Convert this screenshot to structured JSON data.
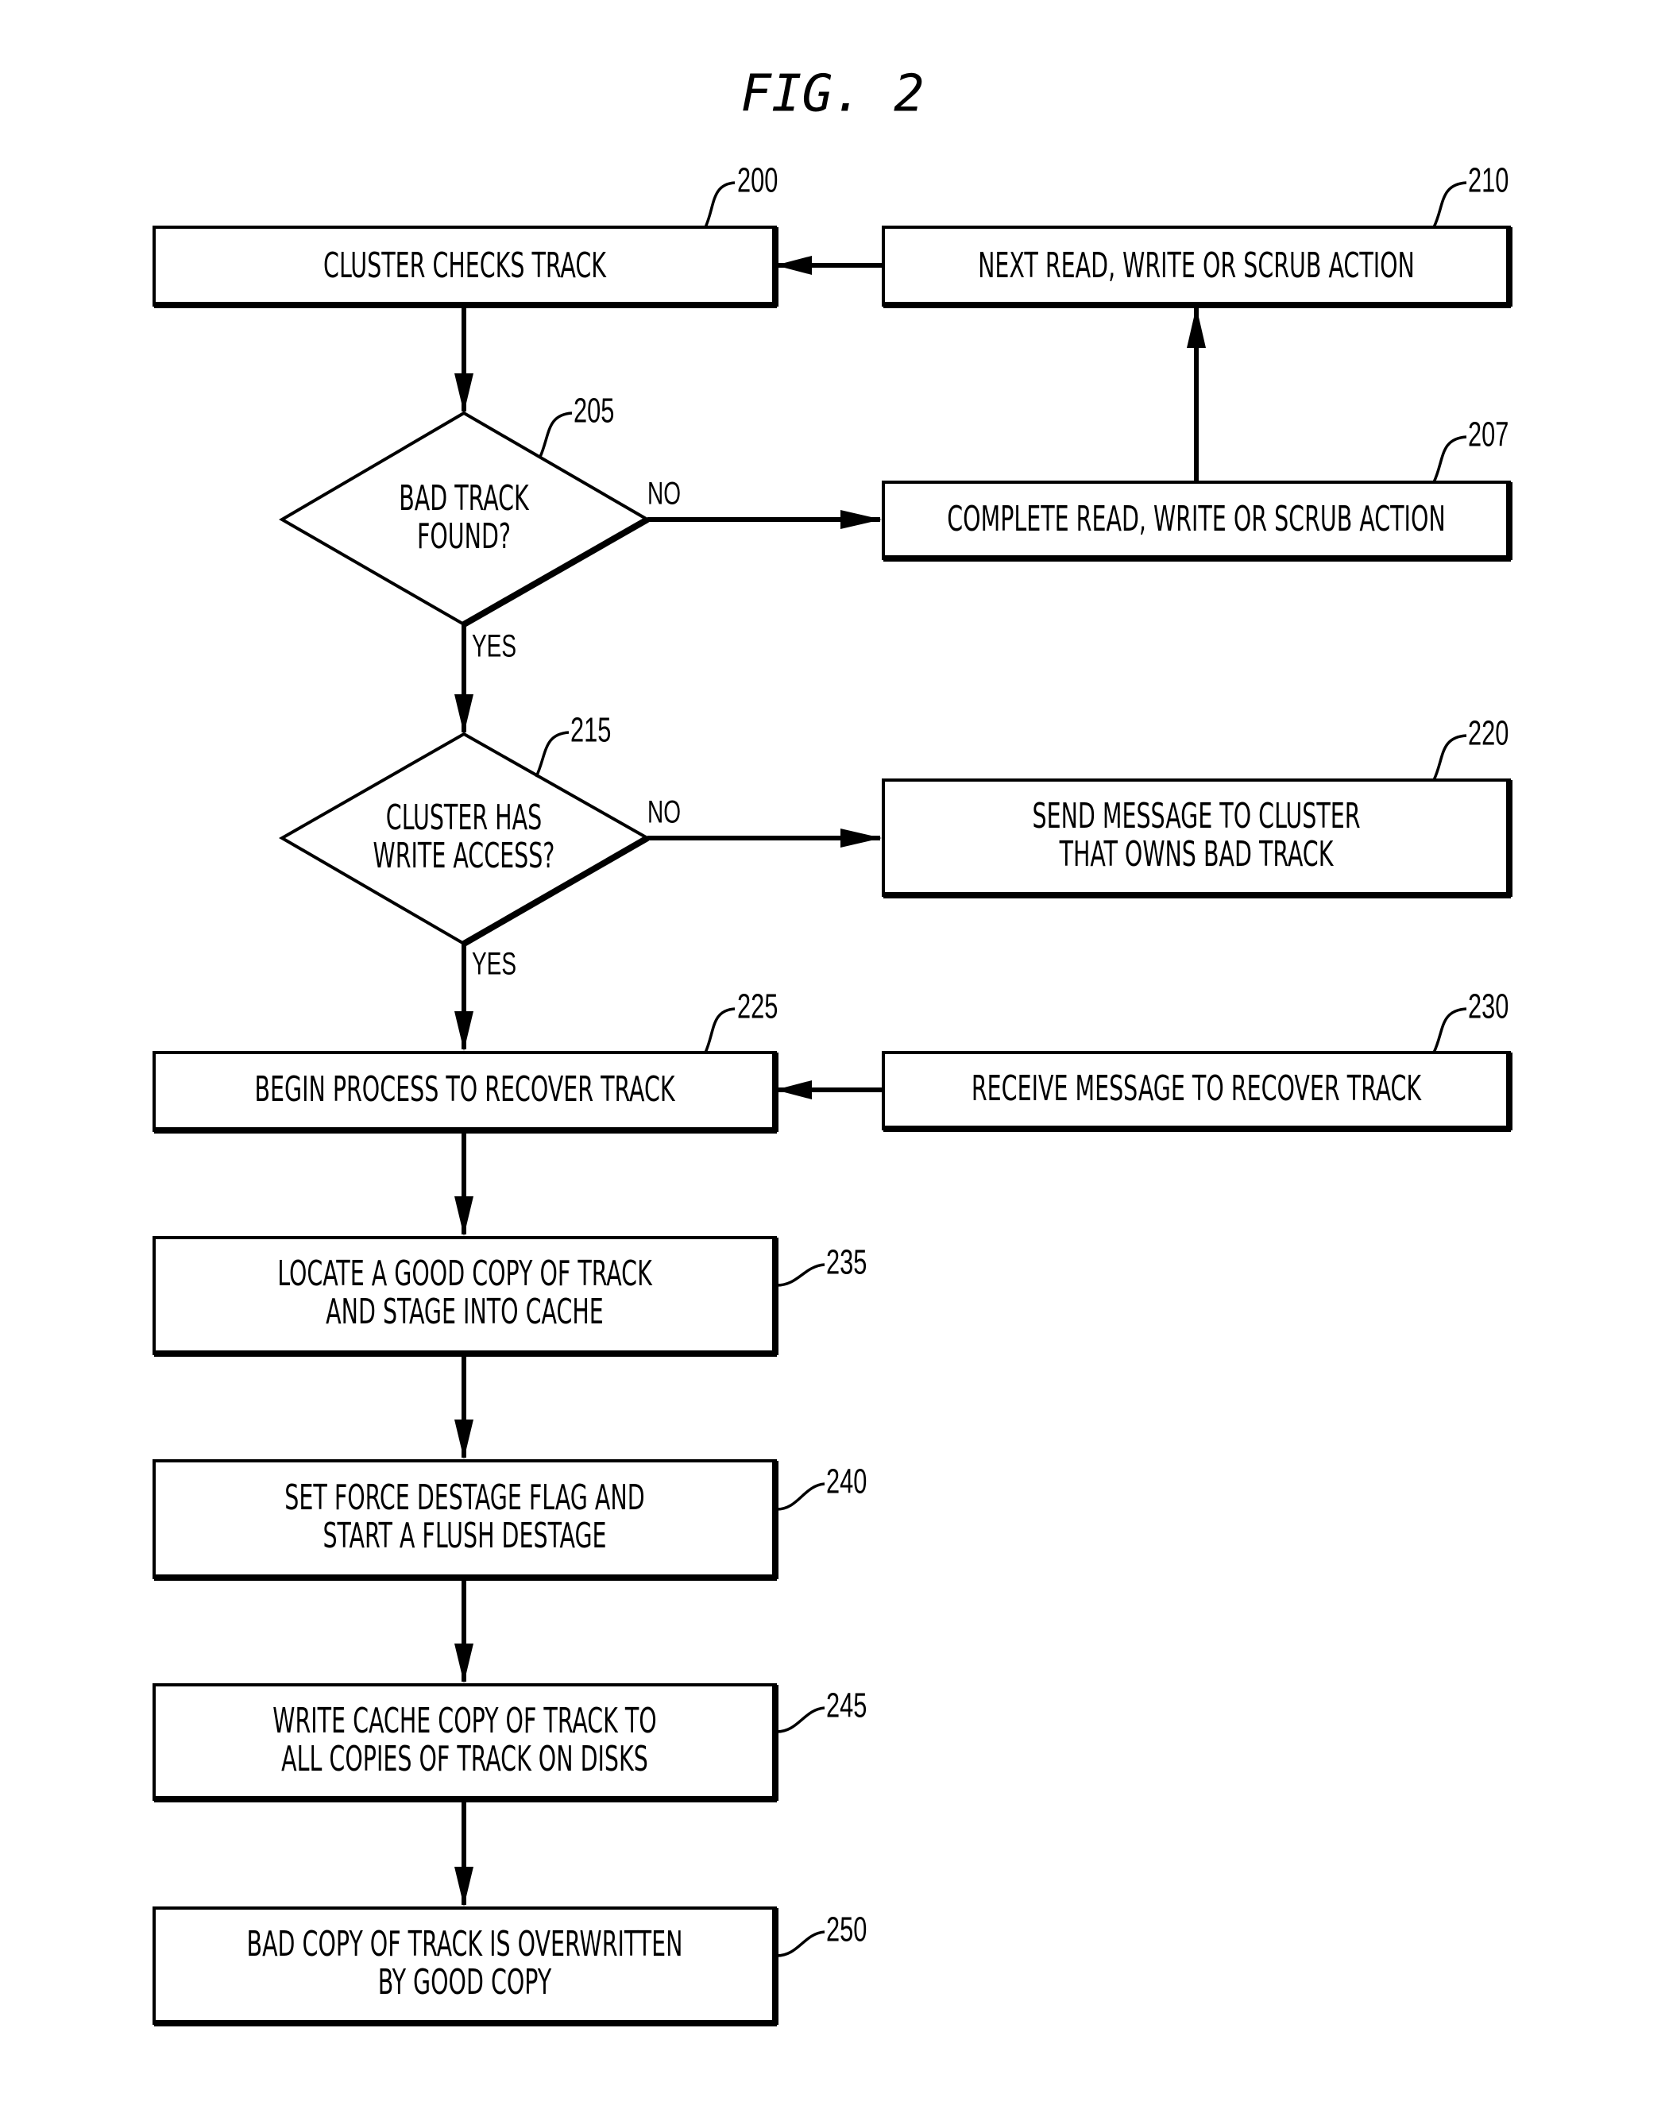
{
  "figure": {
    "title": "FIG. 2"
  },
  "nodes": {
    "n200": {
      "ref": "200",
      "lines": [
        "CLUSTER CHECKS TRACK"
      ]
    },
    "n210": {
      "ref": "210",
      "lines": [
        "NEXT READ, WRITE OR SCRUB ACTION"
      ]
    },
    "n205": {
      "ref": "205",
      "lines": [
        "BAD TRACK",
        "FOUND?"
      ]
    },
    "n207": {
      "ref": "207",
      "lines": [
        "COMPLETE READ, WRITE OR SCRUB ACTION"
      ]
    },
    "n215": {
      "ref": "215",
      "lines": [
        "CLUSTER HAS",
        "WRITE ACCESS?"
      ]
    },
    "n220": {
      "ref": "220",
      "lines": [
        "SEND MESSAGE TO CLUSTER",
        "THAT OWNS BAD TRACK"
      ]
    },
    "n225": {
      "ref": "225",
      "lines": [
        "BEGIN PROCESS TO RECOVER TRACK"
      ]
    },
    "n230": {
      "ref": "230",
      "lines": [
        "RECEIVE MESSAGE TO RECOVER TRACK"
      ]
    },
    "n235": {
      "ref": "235",
      "lines": [
        "LOCATE A GOOD COPY OF TRACK",
        "AND STAGE INTO CACHE"
      ]
    },
    "n240": {
      "ref": "240",
      "lines": [
        "SET FORCE DESTAGE FLAG AND",
        "START A FLUSH DESTAGE"
      ]
    },
    "n245": {
      "ref": "245",
      "lines": [
        "WRITE CACHE COPY OF TRACK TO",
        "ALL COPIES OF TRACK ON DISKS"
      ]
    },
    "n250": {
      "ref": "250",
      "lines": [
        "BAD COPY OF TRACK IS OVERWRITTEN",
        "BY GOOD COPY"
      ]
    }
  },
  "branches": {
    "d205_no": "NO",
    "d205_yes": "YES",
    "d215_no": "NO",
    "d215_yes": "YES"
  },
  "edges": [
    {
      "from": "200",
      "to": "205"
    },
    {
      "from": "205",
      "to": "207",
      "label": "NO"
    },
    {
      "from": "205",
      "to": "215",
      "label": "YES"
    },
    {
      "from": "207",
      "to": "210"
    },
    {
      "from": "210",
      "to": "200"
    },
    {
      "from": "215",
      "to": "220",
      "label": "NO"
    },
    {
      "from": "215",
      "to": "225",
      "label": "YES"
    },
    {
      "from": "230",
      "to": "225"
    },
    {
      "from": "225",
      "to": "235"
    },
    {
      "from": "235",
      "to": "240"
    },
    {
      "from": "240",
      "to": "245"
    },
    {
      "from": "245",
      "to": "250"
    }
  ]
}
